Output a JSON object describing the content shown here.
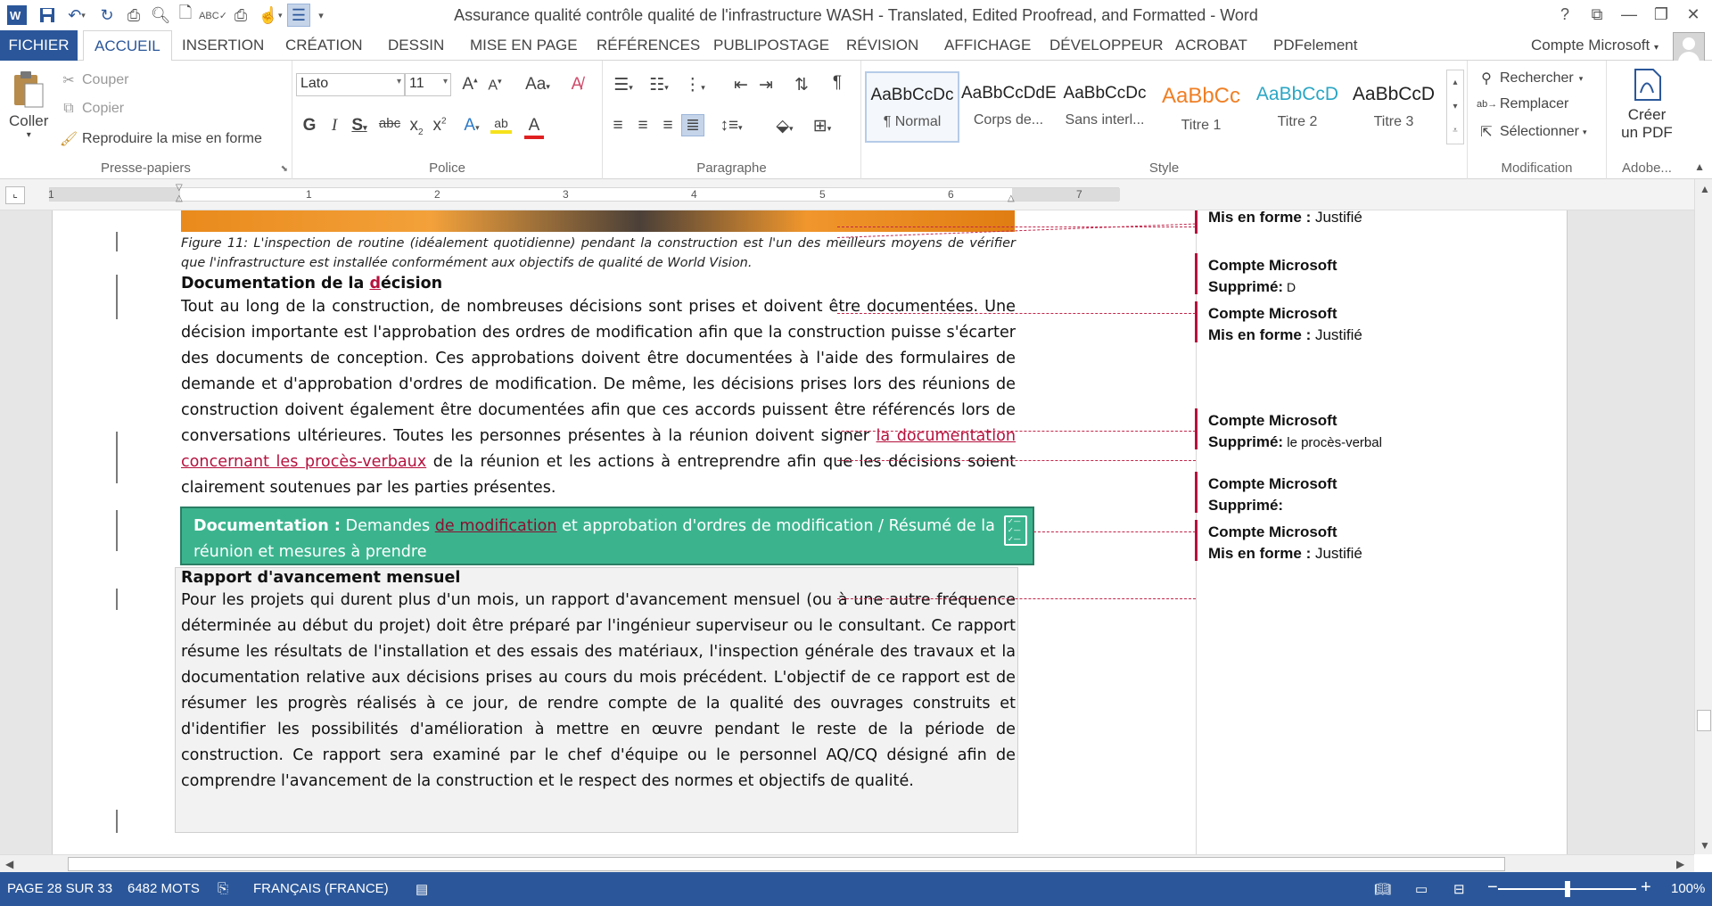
{
  "window": {
    "title": "Assurance qualité  contrôle qualité de l'infrastructure WASH - Translated, Edited Proofread, and Formatted - Word",
    "help": "?",
    "minimize": "—",
    "restore": "❐",
    "close": "✕"
  },
  "menu": {
    "file": "FICHIER",
    "tabs": [
      "ACCUEIL",
      "INSERTION",
      "CRÉATION",
      "DESSIN",
      "MISE EN PAGE",
      "RÉFÉRENCES",
      "PUBLIPOSTAGE",
      "RÉVISION",
      "AFFICHAGE",
      "DÉVELOPPEUR",
      "ACROBAT",
      "PDFelement"
    ],
    "account": "Compte Microsoft"
  },
  "ribbon": {
    "clipboard": {
      "paste": "Coller",
      "cut": "Couper",
      "copy": "Copier",
      "format_painter": "Reproduire la mise en forme",
      "label": "Presse-papiers"
    },
    "font": {
      "name": "Lato",
      "size": "11",
      "label": "Police"
    },
    "paragraph": {
      "label": "Paragraphe"
    },
    "styles": {
      "label": "Style",
      "items": [
        {
          "sample": "AaBbCcDc",
          "name": "¶ Normal",
          "color": "#222222"
        },
        {
          "sample": "AaBbCcDdE",
          "name": "Corps de...",
          "color": "#222222"
        },
        {
          "sample": "AaBbCcDc",
          "name": "Sans interl...",
          "color": "#222222"
        },
        {
          "sample": "AaBbCc",
          "name": "Titre 1",
          "color": "#f07f24"
        },
        {
          "sample": "AaBbCcD",
          "name": "Titre 2",
          "color": "#2aa6c4"
        },
        {
          "sample": "AaBbCcD",
          "name": "Titre 3",
          "color": "#222222"
        }
      ]
    },
    "editing": {
      "find": "Rechercher",
      "replace": "Remplacer",
      "select": "Sélectionner",
      "label": "Modification"
    },
    "adobe": {
      "create_pdf_1": "Créer",
      "create_pdf_2": "un PDF",
      "label": "Adobe..."
    }
  },
  "ruler": {
    "numbers": [
      "1",
      "1",
      "2",
      "3",
      "4",
      "5",
      "6",
      "7"
    ]
  },
  "document": {
    "caption": "Figure 11: L'inspection de routine (idéalement quotidienne) pendant la construction est l'un des meilleurs moyens de vérifier que l'infrastructure est installée conformément aux objectifs de qualité de World Vision.",
    "heading1_a": "Documentation de la ",
    "heading1_ins": "d",
    "heading1_b": "écision",
    "para1_a": "Tout au long de la construction, de nombreuses décisions sont prises et doivent être documentées. Une décision importante est l'approbation des ordres de modification afin que la construction puisse s'écarter des documents de conception. Ces approbations doivent être documentées à l'aide des formulaires de demande et d'approbation d'ordres de modification. De même, les décisions prises lors des réunions de construction doivent également être documentées afin que ces accords puissent être référencés lors de conversations ultérieures. Toutes les personnes présentes à la réunion doivent signer ",
    "para1_ins": "la documentation concernant les procès-verbaux",
    "para1_b": " de la réunion et les actions à entreprendre afin que les décisions soient clairement soutenues par les parties présentes.",
    "box_label": "Documentation :",
    "box_a": " Demandes ",
    "box_ins": "de modification",
    "box_b": " et approbation d'ordres de modification / Résumé de la réunion et mesures à prendre",
    "heading2": "Rapport d'avancement mensuel",
    "para2": "Pour les projets qui durent plus d'un mois, un rapport d'avancement mensuel (ou à une autre fréquence déterminée au début du projet) doit être préparé par l'ingénieur superviseur ou le consultant. Ce rapport résume les résultats de l'installation et des essais des matériaux, l'inspection générale des travaux et la documentation relative aux décisions prises au cours du mois précédent. L'objectif de ce rapport est de résumer les progrès réalisés à ce jour, de rendre compte de la qualité des ouvrages construits et d'identifier les possibilités d'amélioration à mettre en œuvre pendant le reste de la période de construction. Ce rapport sera examiné par le chef d'équipe ou le personnel AQ/CQ désigné afin de comprendre l'avancement de la construction et le respect des normes et objectifs de qualité."
  },
  "comments": [
    {
      "author": "",
      "label": "Mis en forme :",
      "value": " Justifié"
    },
    {
      "author": "Compte Microsoft",
      "label": "Supprimé:",
      "value": " D"
    },
    {
      "author": "Compte Microsoft",
      "label": "Mis en forme :",
      "value": " Justifié"
    },
    {
      "author": "Compte Microsoft",
      "label": "Supprimé:",
      "value": " le procès-verbal"
    },
    {
      "author": "Compte Microsoft",
      "label": "Supprimé:",
      "value": ""
    },
    {
      "author": "Compte Microsoft",
      "label": "Mis en forme :",
      "value": " Justifié"
    }
  ],
  "status": {
    "page": "PAGE 28 SUR 33",
    "words": "6482 MOTS",
    "language": "FRANÇAIS (FRANCE)",
    "zoom": "100%",
    "zoom_minus": "−",
    "zoom_plus": "+"
  },
  "colors": {
    "brand": "#2b579a",
    "revision": "#b5123e",
    "callout_green": "#3bb48e"
  }
}
